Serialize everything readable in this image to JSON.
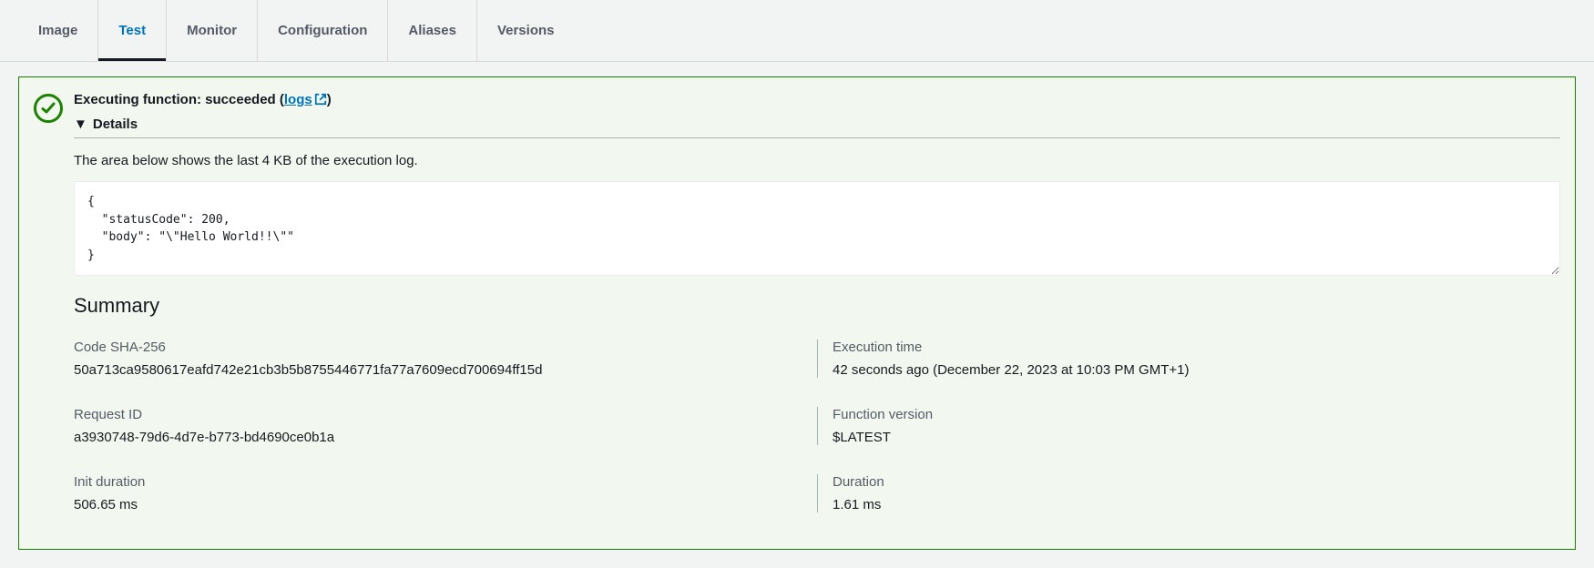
{
  "tabs": {
    "image": "Image",
    "test": "Test",
    "monitor": "Monitor",
    "configuration": "Configuration",
    "aliases": "Aliases",
    "versions": "Versions"
  },
  "result": {
    "title_prefix": "Executing function: succeeded (",
    "logs_label": "logs",
    "title_suffix": ")",
    "details_label": "Details",
    "hint": "The area below shows the last 4 KB of the execution log.",
    "log_output": "{\n  \"statusCode\": 200,\n  \"body\": \"\\\"Hello World!!\\\"\"\n}",
    "summary_heading": "Summary"
  },
  "summary": {
    "code_sha_label": "Code SHA-256",
    "code_sha_value": "50a713ca9580617eafd742e21cb3b5b8755446771fa77a7609ecd700694ff15d",
    "exec_time_label": "Execution time",
    "exec_time_value": "42 seconds ago (December 22, 2023 at 10:03 PM GMT+1)",
    "request_id_label": "Request ID",
    "request_id_value": "a3930748-79d6-4d7e-b773-bd4690ce0b1a",
    "func_version_label": "Function version",
    "func_version_value": "$LATEST",
    "init_duration_label": "Init duration",
    "init_duration_value": "506.65 ms",
    "duration_label": "Duration",
    "duration_value": "1.61 ms"
  }
}
